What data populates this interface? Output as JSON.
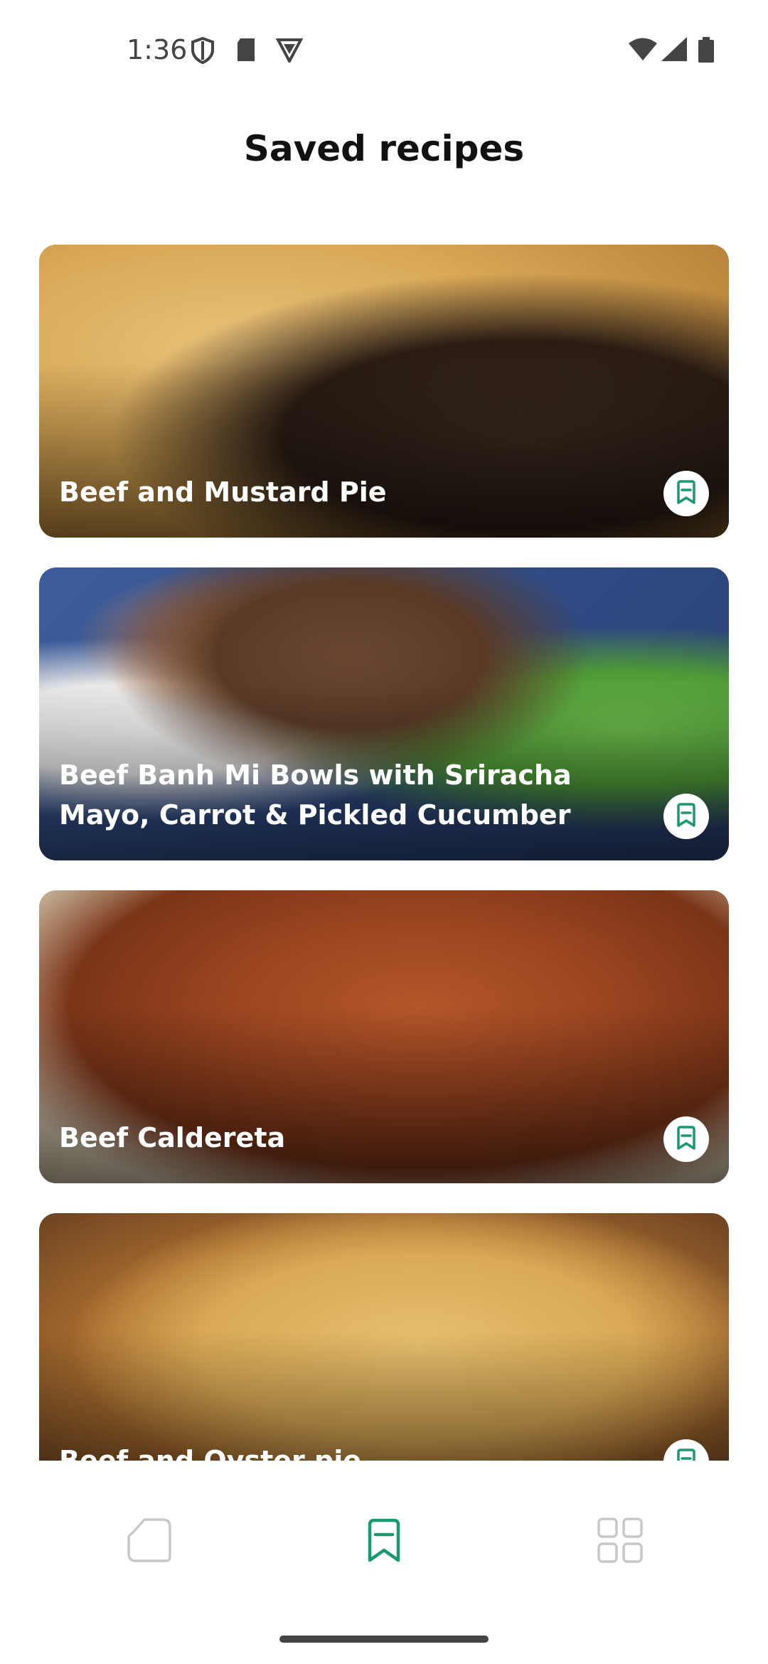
{
  "status_bar": {
    "time": "1:36",
    "icons": [
      "shield-icon",
      "sd-card-icon",
      "vpn-icon",
      "wifi-icon",
      "signal-icon",
      "battery-icon"
    ]
  },
  "page": {
    "title": "Saved recipes"
  },
  "recipes": [
    {
      "name": "Beef and Mustard Pie",
      "image": "beef-pie-image"
    },
    {
      "name": "Beef Banh Mi Bowls with Sriracha Mayo, Carrot & Pickled Cucumber",
      "image": "banh-mi-bowl-image"
    },
    {
      "name": "Beef Caldereta",
      "image": "caldereta-image"
    },
    {
      "name": "Beef and Oyster pie",
      "image": "oyster-pie-image"
    }
  ],
  "bottom_nav": {
    "items": [
      {
        "icon": "home-icon",
        "active": false
      },
      {
        "icon": "bookmark-icon",
        "active": true
      },
      {
        "icon": "grid-icon",
        "active": false
      }
    ]
  },
  "colors": {
    "accent": "#1a9a6c",
    "inactive": "#c8c8c8"
  }
}
